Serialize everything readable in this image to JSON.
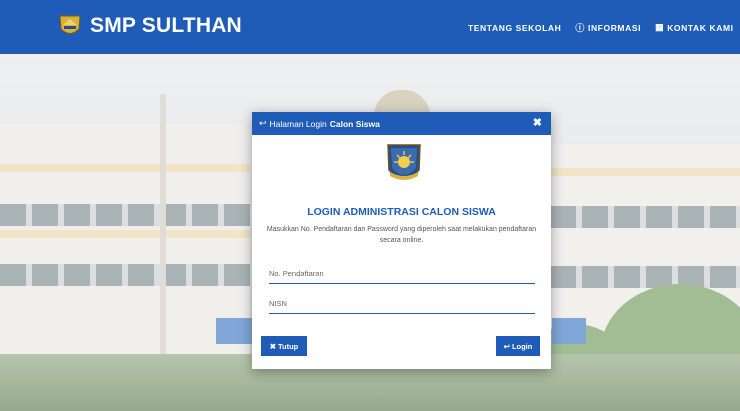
{
  "navbar": {
    "brand": "SMP SULTHAN",
    "logo_icon": "school-crest-icon",
    "links": [
      {
        "label": "TENTANG SEKOLAH",
        "icon": ""
      },
      {
        "label": "INFORMASI",
        "icon": "info-circle-icon"
      },
      {
        "label": "KONTAK KAMI",
        "icon": "contact-card-icon"
      }
    ]
  },
  "modal": {
    "header_prefix": "Halaman Login",
    "header_bold": "Calon Siswa",
    "header_icon": "sign-in-icon",
    "close_icon": "close-icon",
    "title": "LOGIN ADMINISTRASI CALON SISWA",
    "description": "Masukkan No. Pendaftaran dan Password yang diperoleh saat melakukan pendaftaran secara online.",
    "fields": {
      "registration": {
        "placeholder": "No. Pendaftaran",
        "value": ""
      },
      "nisn": {
        "placeholder": "NISN",
        "value": ""
      }
    },
    "buttons": {
      "close": "Tutup",
      "login": "Login"
    }
  },
  "colors": {
    "primary": "#1e5cb8",
    "text_muted": "#555555"
  }
}
